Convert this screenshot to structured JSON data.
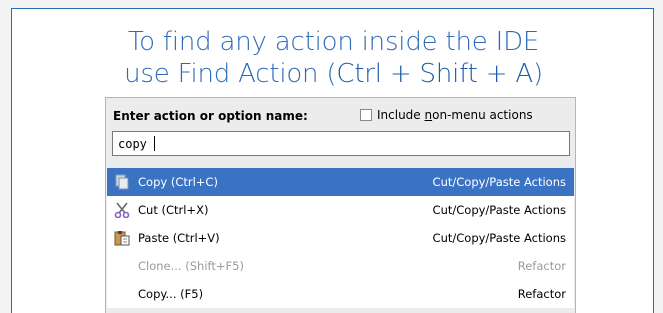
{
  "heading": {
    "line1": "To find any action inside the IDE",
    "line2_prefix": "use Find Action (",
    "line2_shortcut": "Ctrl + Shift + A",
    "line2_suffix": ")"
  },
  "dialog": {
    "prompt": "Enter action or option name:",
    "checkbox": {
      "checked": false,
      "label_pre": "Include ",
      "label_mnemonic": "n",
      "label_post": "on-menu actions"
    },
    "search": {
      "value": "copy"
    },
    "results": [
      {
        "label": "Copy (Ctrl+C)",
        "group": "Cut/Copy/Paste Actions",
        "icon": "copy-icon",
        "selected": true,
        "disabled": false
      },
      {
        "label": "Cut (Ctrl+X)",
        "group": "Cut/Copy/Paste Actions",
        "icon": "scissors-icon",
        "selected": false,
        "disabled": false
      },
      {
        "label": "Paste (Ctrl+V)",
        "group": "Cut/Copy/Paste Actions",
        "icon": "paste-icon",
        "selected": false,
        "disabled": false
      },
      {
        "label": "Clone... (Shift+F5)",
        "group": "Refactor",
        "icon": "",
        "selected": false,
        "disabled": true
      },
      {
        "label": "Copy... (F5)",
        "group": "Refactor",
        "icon": "",
        "selected": false,
        "disabled": false
      }
    ]
  },
  "colors": {
    "accent": "#2f6ab8",
    "selection": "#3b73c4",
    "dialog_bg": "#ececec",
    "disabled_text": "#9a9a9a"
  }
}
